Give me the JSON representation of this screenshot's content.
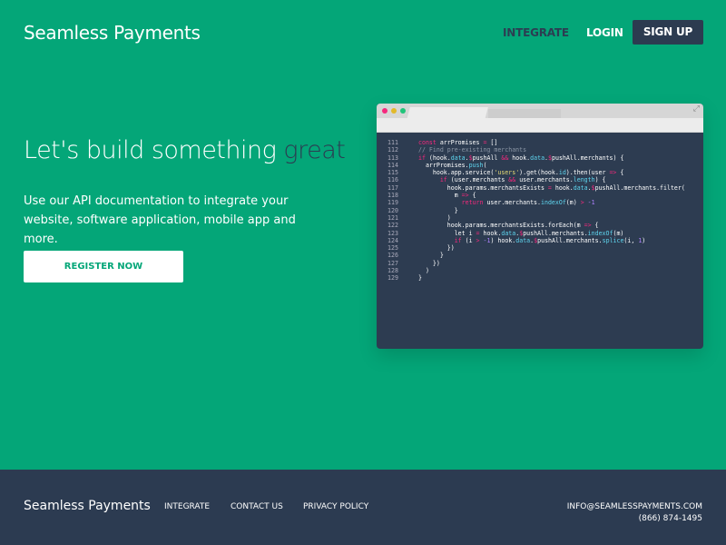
{
  "header": {
    "logo": "Seamless Payments",
    "nav": {
      "integrate": "INTEGRATE",
      "login": "LOGIN",
      "signup": "SIGN UP"
    }
  },
  "hero": {
    "title_main": "Let's build something ",
    "title_accent": "great",
    "subtitle": "Use our API documentation to integrate your website, software application, mobile app and more.",
    "cta": "REGISTER NOW"
  },
  "colors": {
    "brand_green": "#04a678",
    "navy": "#2c3b51",
    "close": "#f6287d",
    "minimize": "#e2b92a",
    "maximize": "#20c47a"
  },
  "code": {
    "lines": [
      {
        "n": "111",
        "t": [
          [
            "k",
            "const"
          ],
          [
            "p",
            " arrPromises "
          ],
          [
            "k",
            "="
          ],
          [
            "p",
            " []"
          ]
        ]
      },
      {
        "n": "112",
        "t": [
          [
            "c",
            "// Find pre-existing merchants"
          ]
        ]
      },
      {
        "n": "113",
        "t": [
          [
            "k",
            "if"
          ],
          [
            "p",
            " (hook."
          ],
          [
            "f",
            "data"
          ],
          [
            "p",
            "."
          ],
          [
            "k",
            "$"
          ],
          [
            "p",
            "pushAll "
          ],
          [
            "k",
            "&&"
          ],
          [
            "p",
            " hook."
          ],
          [
            "f",
            "data"
          ],
          [
            "p",
            "."
          ],
          [
            "k",
            "$"
          ],
          [
            "p",
            "pushAll.merchants) {"
          ]
        ]
      },
      {
        "n": "114",
        "t": [
          [
            "p",
            "  arrPromises."
          ],
          [
            "f",
            "push"
          ],
          [
            "p",
            "("
          ]
        ]
      },
      {
        "n": "115",
        "t": [
          [
            "p",
            "    hook.app.service("
          ],
          [
            "s",
            "'users'"
          ],
          [
            "p",
            ").get(hook."
          ],
          [
            "f",
            "id"
          ],
          [
            "p",
            ").then(user "
          ],
          [
            "k",
            "=>"
          ],
          [
            "p",
            " {"
          ]
        ]
      },
      {
        "n": "116",
        "t": [
          [
            "p",
            "      "
          ],
          [
            "k",
            "if"
          ],
          [
            "p",
            " (user.merchants "
          ],
          [
            "k",
            "&&"
          ],
          [
            "p",
            " user.merchants."
          ],
          [
            "f",
            "length"
          ],
          [
            "p",
            ") {"
          ]
        ]
      },
      {
        "n": "117",
        "t": [
          [
            "p",
            "        hook.params.merchantsExists "
          ],
          [
            "k",
            "="
          ],
          [
            "p",
            " hook."
          ],
          [
            "f",
            "data"
          ],
          [
            "p",
            "."
          ],
          [
            "k",
            "$"
          ],
          [
            "p",
            "pushAll.merchants.filter("
          ]
        ]
      },
      {
        "n": "118",
        "t": [
          [
            "p",
            "          m "
          ],
          [
            "k",
            "=>"
          ],
          [
            "p",
            " {"
          ]
        ]
      },
      {
        "n": "119",
        "t": [
          [
            "p",
            "            "
          ],
          [
            "k",
            "return"
          ],
          [
            "p",
            " user.merchants."
          ],
          [
            "f",
            "indexOf"
          ],
          [
            "p",
            "(m) "
          ],
          [
            "k",
            ">"
          ],
          [
            "p",
            " "
          ],
          [
            "n",
            "-1"
          ]
        ]
      },
      {
        "n": "120",
        "t": [
          [
            "p",
            "          }"
          ]
        ]
      },
      {
        "n": "121",
        "t": [
          [
            "p",
            "        )"
          ]
        ]
      },
      {
        "n": "122",
        "t": [
          [
            "p",
            "        hook.params.merchantsExists.forEach(m "
          ],
          [
            "k",
            "=>"
          ],
          [
            "p",
            " {"
          ]
        ]
      },
      {
        "n": "123",
        "t": [
          [
            "p",
            "          let i "
          ],
          [
            "k",
            "="
          ],
          [
            "p",
            " hook."
          ],
          [
            "f",
            "data"
          ],
          [
            "p",
            "."
          ],
          [
            "k",
            "$"
          ],
          [
            "p",
            "pushAll.merchants."
          ],
          [
            "f",
            "indexOf"
          ],
          [
            "p",
            "(m)"
          ]
        ]
      },
      {
        "n": "124",
        "t": [
          [
            "p",
            "          "
          ],
          [
            "k",
            "if"
          ],
          [
            "p",
            " (i "
          ],
          [
            "k",
            ">"
          ],
          [
            "p",
            " "
          ],
          [
            "n",
            "-1"
          ],
          [
            "p",
            ") hook."
          ],
          [
            "f",
            "data"
          ],
          [
            "p",
            "."
          ],
          [
            "k",
            "$"
          ],
          [
            "p",
            "pushAll.merchants."
          ],
          [
            "f",
            "splice"
          ],
          [
            "p",
            "(i, "
          ],
          [
            "n",
            "1"
          ],
          [
            "p",
            ")"
          ]
        ]
      },
      {
        "n": "125",
        "t": [
          [
            "p",
            "        })"
          ]
        ]
      },
      {
        "n": "126",
        "t": [
          [
            "p",
            "      }"
          ]
        ]
      },
      {
        "n": "127",
        "t": [
          [
            "p",
            "    })"
          ]
        ]
      },
      {
        "n": "128",
        "t": [
          [
            "p",
            "  )"
          ]
        ]
      },
      {
        "n": "129",
        "t": [
          [
            "p",
            "}"
          ]
        ]
      }
    ]
  },
  "footer": {
    "logo": "Seamless Payments",
    "links": [
      "INTEGRATE",
      "CONTACT US",
      "PRIVACY POLICY"
    ],
    "email": "INFO@SEAMLESSPAYMENTS.COM",
    "phone": "(866) 874-1495"
  }
}
